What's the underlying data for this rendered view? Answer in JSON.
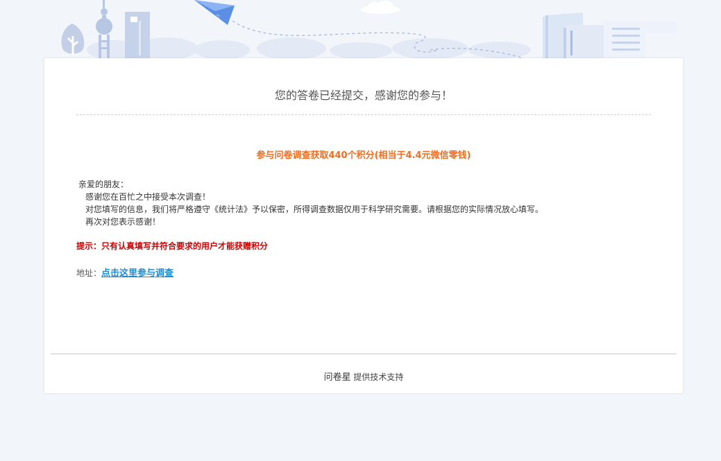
{
  "header": {
    "title": "您的答卷已经提交，感谢您的参与！"
  },
  "reward": {
    "headline": "参与问卷调查获取440个积分(相当于4.4元微信零钱)"
  },
  "letter": {
    "greeting": "亲爱的朋友：",
    "lines": [
      "感谢您在百忙之中接受本次调查！",
      "对您填写的信息，我们将严格遵守《统计法》予以保密，所得调查数据仅用于科学研究需要。请根据您的实际情况放心填写。",
      "再次对您表示感谢！"
    ]
  },
  "notice": "提示：只有认真填写并符合要求的用户才能获赠积分",
  "address": {
    "label": "地址：",
    "link_text": "点击这里参与调查"
  },
  "footer": {
    "brand": "问卷星",
    "tagline": " 提供技术支持"
  },
  "colors": {
    "page_bg": "#f2f5fa",
    "headline_orange": "#f06d1f",
    "notice_red": "#d40000",
    "link_blue": "#1a8cd8"
  },
  "icons": [
    "tree-icon",
    "tower-icon",
    "skyscraper-icon",
    "paper-plane-icon",
    "cloud-icon",
    "books-icon",
    "paper-icon"
  ]
}
